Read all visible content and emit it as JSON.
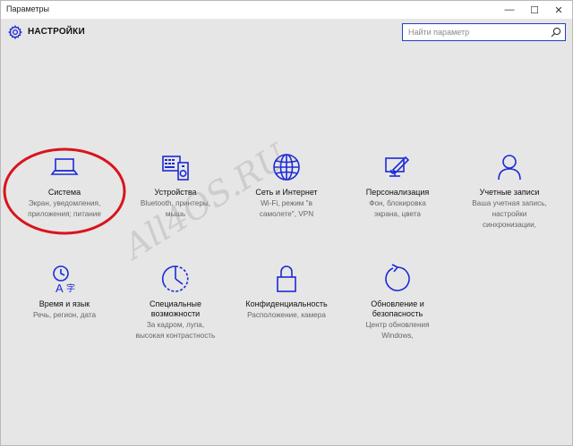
{
  "window": {
    "title": "Параметры",
    "minimize": "—",
    "maximize": "☐",
    "close": "✕"
  },
  "header": {
    "title": "НАСТРОЙКИ",
    "search_placeholder": "Найти параметр"
  },
  "tiles": [
    {
      "title": "Система",
      "sub": [
        "Экран, уведомления,",
        "приложения; питание"
      ],
      "icon": "laptop-icon"
    },
    {
      "title": "Устройства",
      "sub": [
        "Bluetooth, принтеры,",
        "мышь"
      ],
      "icon": "devices-icon"
    },
    {
      "title": "Сеть и Интернет",
      "sub": [
        "Wi-Fi, режим \"в",
        "самолете\", VPN"
      ],
      "icon": "globe-icon"
    },
    {
      "title": "Персонализация",
      "sub": [
        "Фон, блокировка",
        "экрана, цвета"
      ],
      "icon": "paint-icon"
    },
    {
      "title": "Учетные записи",
      "sub": [
        "Ваша учетная запись,",
        "настройки",
        "синхронизации,"
      ],
      "icon": "person-icon"
    },
    {
      "title": "Время и язык",
      "sub": [
        "Речь, регион, дата"
      ],
      "icon": "time-language-icon"
    },
    {
      "title": "Специальные",
      "title2": "возможности",
      "sub": [
        "За кадром, лупа,",
        "высокая контрастность"
      ],
      "icon": "accessibility-icon"
    },
    {
      "title": "Конфиденциальность",
      "sub": [
        "Расположение, камера"
      ],
      "icon": "lock-icon"
    },
    {
      "title": "Обновление и",
      "title2": "безопасность",
      "sub": [
        "Центр обновления",
        "Windows,"
      ],
      "icon": "update-icon"
    }
  ],
  "watermark": "All4OS.RU",
  "colors": {
    "accent": "#1b2bd6",
    "annotation": "#d8141c"
  }
}
